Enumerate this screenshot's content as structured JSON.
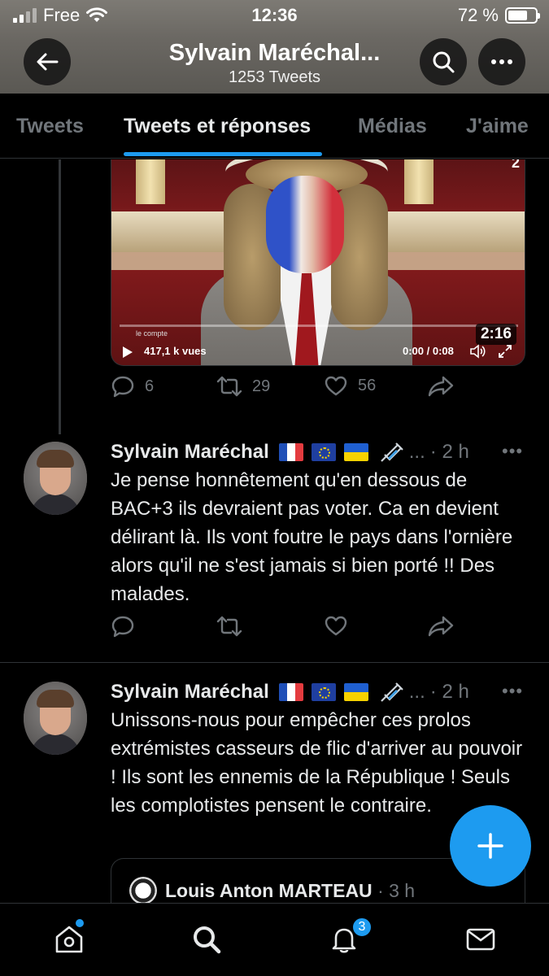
{
  "status_bar": {
    "carrier": "Free",
    "time": "12:36",
    "battery": "72 %"
  },
  "header": {
    "title": "Sylvain Maréchal...",
    "subtitle": "1253 Tweets"
  },
  "tabs": [
    {
      "label": "Tweets",
      "active": false
    },
    {
      "label": "Tweets et réponses",
      "active": true
    },
    {
      "label": "Médias",
      "active": false
    },
    {
      "label": "J'aime",
      "active": false
    }
  ],
  "video": {
    "duration": "2:16",
    "views": "417,1 k vues",
    "time": "0:00 / 0:08",
    "watermark": "le compte",
    "channel": "2"
  },
  "first_actions": {
    "replies": "6",
    "retweets": "29",
    "likes": "56"
  },
  "tweets": [
    {
      "name": "Sylvain Maréchal",
      "ellipsis": "...",
      "time": "· 2 h",
      "more": "•••",
      "text": "Je pense honnêtement qu'en dessous de BAC+3 ils devraient pas voter. Ca en devient délirant là. Ils vont foutre le pays dans l'ornière alors qu'il ne s'est jamais si bien porté !! Des malades."
    },
    {
      "name": "Sylvain Maréchal",
      "ellipsis": "...",
      "time": "· 2 h",
      "more": "•••",
      "text": "Unissons-nous pour empêcher ces prolos extrémistes casseurs de flic d'arriver au pouvoir ! Ils sont les ennemis de la République ! Seuls les complotistes pensent le contraire."
    }
  ],
  "quote": {
    "name": "Louis Anton MARTEAU",
    "time": "· 3 h"
  },
  "bottom_nav": {
    "notifications_badge": "3"
  },
  "colors": {
    "accent": "#1d9bf0",
    "background": "#000000",
    "muted": "#71767b"
  }
}
